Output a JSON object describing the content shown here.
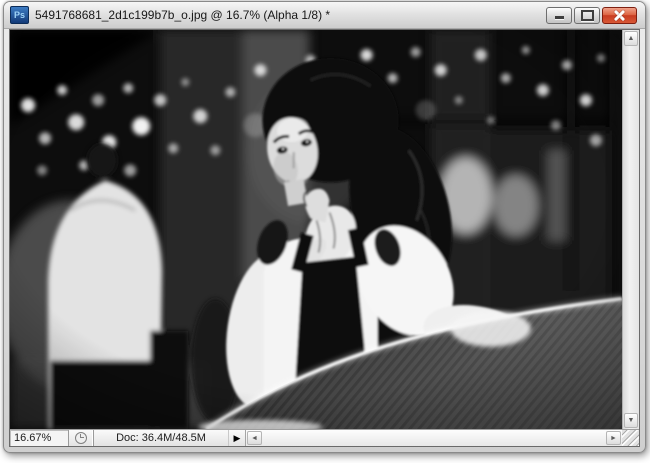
{
  "window": {
    "app_icon_text": "Ps",
    "title": "5491768681_2d1c199b7b_o.jpg @ 16.7% (Alpha 1/8) *"
  },
  "status_bar": {
    "zoom_value": "16.67%",
    "doc_info": "Doc: 36.4M/48.5M",
    "menu_arrow_glyph": "▶"
  },
  "scrollbars": {
    "up_glyph": "▲",
    "down_glyph": "▼",
    "left_glyph": "◄",
    "right_glyph": "►"
  },
  "icons": {
    "app": "photoshop-ps-logo",
    "minimize": "horizontal-bar",
    "maximize": "square-outline",
    "close": "x-cross",
    "status_circle": "sync-status-circle",
    "resize_grip": "diagonal-ridges"
  },
  "colors": {
    "titlebar_top": "#f7f7f7",
    "titlebar_bottom": "#cdcdcd",
    "close_button": "#c83c22",
    "ps_icon_bg": "#123a78",
    "ps_icon_text": "#9fd4f8",
    "canvas_bg": "#0d0d0d"
  }
}
